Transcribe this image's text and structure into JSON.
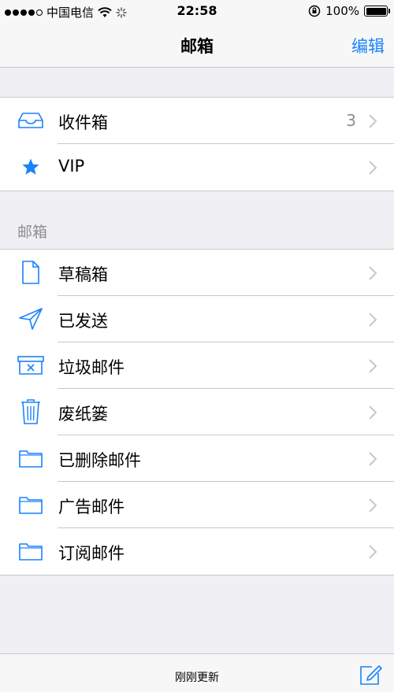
{
  "status_bar": {
    "carrier": "中国电信",
    "time": "22:58",
    "battery": "100%",
    "signal_bars": 4,
    "signal_total": 5
  },
  "nav": {
    "title": "邮箱",
    "edit_label": "编辑"
  },
  "top_group": [
    {
      "label": "收件箱",
      "badge": "3",
      "icon": "inbox-tray-icon"
    },
    {
      "label": "VIP",
      "badge": "",
      "icon": "star-icon"
    }
  ],
  "section_header": "邮箱",
  "mailbox_group": [
    {
      "label": "草稿箱",
      "icon": "document-icon"
    },
    {
      "label": "已发送",
      "icon": "paper-plane-icon"
    },
    {
      "label": "垃圾邮件",
      "icon": "junk-box-icon"
    },
    {
      "label": "废纸篓",
      "icon": "trash-icon"
    },
    {
      "label": "已删除邮件",
      "icon": "folder-icon"
    },
    {
      "label": "广告邮件",
      "icon": "folder-icon"
    },
    {
      "label": "订阅邮件",
      "icon": "folder-icon"
    }
  ],
  "toolbar": {
    "status": "刚刚更新",
    "compose_icon": "compose-icon"
  },
  "colors": {
    "accent": "#1a82fb",
    "background": "#efeff4",
    "secondary_text": "#8e8e93"
  }
}
